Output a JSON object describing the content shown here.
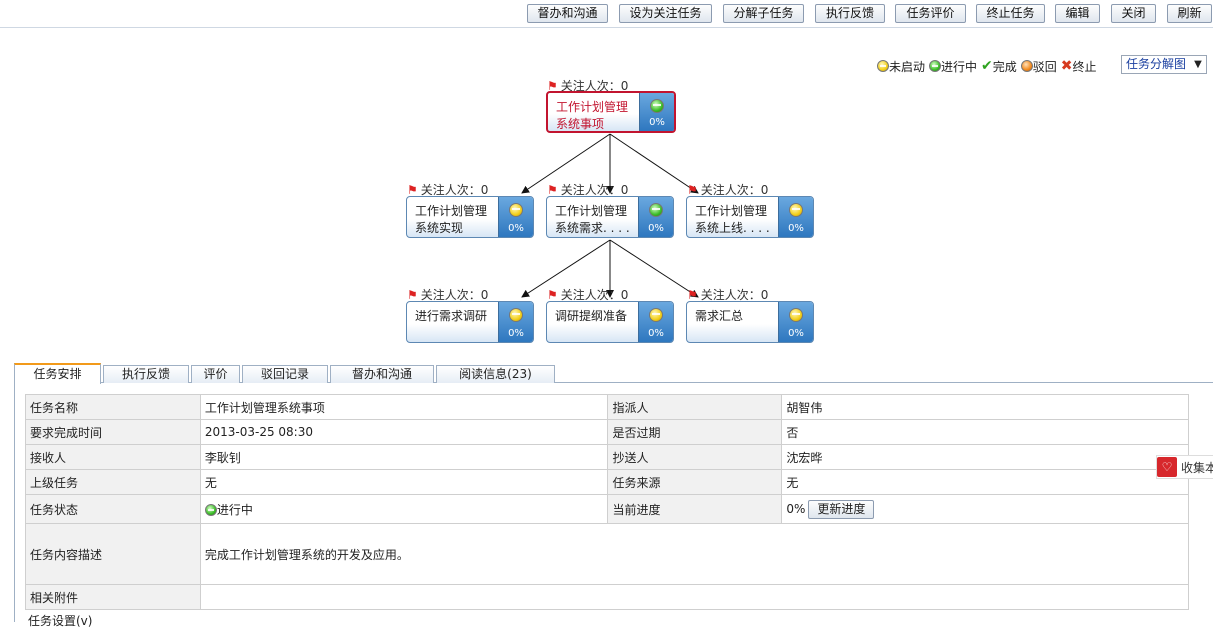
{
  "toolbar": {
    "buttons": [
      "督办和沟通",
      "设为关注任务",
      "分解子任务",
      "执行反馈",
      "任务评价",
      "终止任务",
      "编辑",
      "关闭",
      "刷新"
    ]
  },
  "legend": {
    "not_started": "未启动",
    "in_progress": "进行中",
    "done": "完成",
    "rejected": "驳回",
    "terminated": "终止"
  },
  "view_select": {
    "value": "任务分解图"
  },
  "tree": {
    "follow_label": "关注人次：0",
    "nodes": [
      {
        "line1": "工作计划管理",
        "line2": "系统事项",
        "status": "green",
        "pct": "0%"
      },
      {
        "line1": "工作计划管理",
        "line2": "系统实现",
        "status": "yellow",
        "pct": "0%"
      },
      {
        "line1": "工作计划管理",
        "line2": "系统需求. . . .",
        "status": "green",
        "pct": "0%"
      },
      {
        "line1": "工作计划管理",
        "line2": "系统上线. . . .",
        "status": "yellow",
        "pct": "0%"
      },
      {
        "line1": "进行需求调研",
        "line2": "",
        "status": "yellow",
        "pct": "0%"
      },
      {
        "line1": "调研提纲准备",
        "line2": "",
        "status": "yellow",
        "pct": "0%"
      },
      {
        "line1": "需求汇总",
        "line2": "",
        "status": "yellow",
        "pct": "0%"
      }
    ]
  },
  "tabs": [
    "任务安排",
    "执行反馈",
    "评价",
    "驳回记录",
    "督办和沟通",
    "阅读信息(23)"
  ],
  "info": {
    "task_name_label": "任务名称",
    "task_name": "工作计划管理系统事项",
    "assigner_label": "指派人",
    "assigner": "胡智伟",
    "due_label": "要求完成时间",
    "due": "2013-03-25 08:30",
    "overdue_label": "是否过期",
    "overdue": "否",
    "receiver_label": "接收人",
    "receiver": "李耿钊",
    "cc_label": "抄送人",
    "cc": "沈宏晔",
    "parent_label": "上级任务",
    "parent": "无",
    "source_label": "任务来源",
    "source": "无",
    "status_label": "任务状态",
    "status": "进行中",
    "progress_label": "当前进度",
    "progress": "0%",
    "update_button": "更新进度",
    "desc_label": "任务内容描述",
    "desc": "完成工作计划管理系统的开发及应用。",
    "attach_label": "相关附件",
    "attach": "",
    "more_label": "任务设置(v)"
  },
  "favorite": {
    "label": "收集本"
  }
}
